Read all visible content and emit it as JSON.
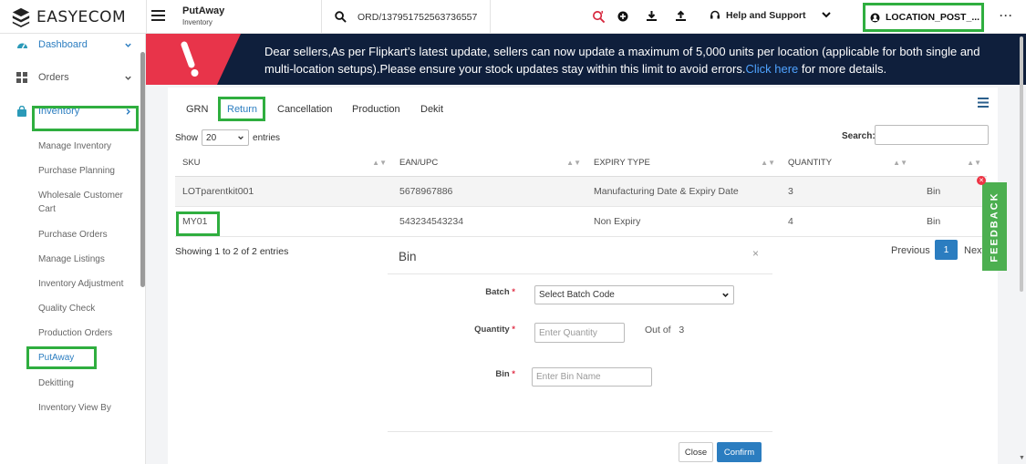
{
  "app": {
    "brand": "EASYECOM"
  },
  "header": {
    "page_title": "PutAway",
    "page_subtitle": "Inventory",
    "search_value": "ORD/137951752563736557",
    "help_label": "Help and Support",
    "location_label": "LOCATION_POST_..."
  },
  "sidebar": {
    "main": [
      {
        "label": "Dashboard"
      },
      {
        "label": "Orders"
      },
      {
        "label": "Inventory"
      }
    ],
    "sub": [
      {
        "label": "Manage Inventory"
      },
      {
        "label": "Purchase Planning"
      },
      {
        "label": "Wholesale Customer Cart"
      },
      {
        "label": "Purchase Orders"
      },
      {
        "label": "Manage Listings"
      },
      {
        "label": "Inventory Adjustment"
      },
      {
        "label": "Quality Check"
      },
      {
        "label": "Production Orders"
      },
      {
        "label": "PutAway"
      },
      {
        "label": "Dekitting"
      },
      {
        "label": "Inventory View By"
      }
    ]
  },
  "banner": {
    "line1": "Dear sellers,As per Flipkart’s latest update, sellers can now update a maximum of 5,000 units per location (applicable for both single and",
    "line2": "multi-location setups).Please ensure your stock updates stay within this limit to avoid errors.",
    "link": "Click here",
    "tail": " for more details."
  },
  "tabs": [
    {
      "label": "GRN"
    },
    {
      "label": "Return"
    },
    {
      "label": "Cancellation"
    },
    {
      "label": "Production"
    },
    {
      "label": "Dekit"
    }
  ],
  "table_controls": {
    "show_label": "Show",
    "entries_value": "20",
    "entries_label": "entries",
    "search_label": "Search:"
  },
  "table": {
    "columns": [
      "SKU",
      "EAN/UPC",
      "EXPIRY TYPE",
      "QUANTITY",
      ""
    ],
    "rows": [
      {
        "sku": "LOTparentkit001",
        "ean": "5678967886",
        "expiry": "Manufacturing Date & Expiry Date",
        "qty": "3",
        "action": "Bin"
      },
      {
        "sku": "MY01",
        "ean": "543234543234",
        "expiry": "Non Expiry",
        "qty": "4",
        "action": "Bin"
      }
    ]
  },
  "pagination": {
    "showing": "Showing 1 to 2 of 2 entries",
    "prev": "Previous",
    "page": "1",
    "next": "Next"
  },
  "modal": {
    "title": "Bin",
    "close_glyph": "×",
    "batch_label": "Batch",
    "batch_value": "Select Batch Code",
    "quantity_label": "Quantity",
    "quantity_placeholder": "Enter Quantity",
    "out_of_label": "Out of",
    "out_of_value": "3",
    "bin_label": "Bin",
    "bin_placeholder": "Enter Bin Name",
    "close_btn": "Close",
    "confirm_btn": "Confirm",
    "required_mark": "*"
  },
  "feedback": {
    "label": "FEEDBACK"
  },
  "colors": {
    "accent": "#2b7dc0",
    "highlight": "#2fae3f",
    "banner_bg": "#0f1f3c",
    "banner_red": "#e8344a",
    "feedback": "#4caf50"
  }
}
